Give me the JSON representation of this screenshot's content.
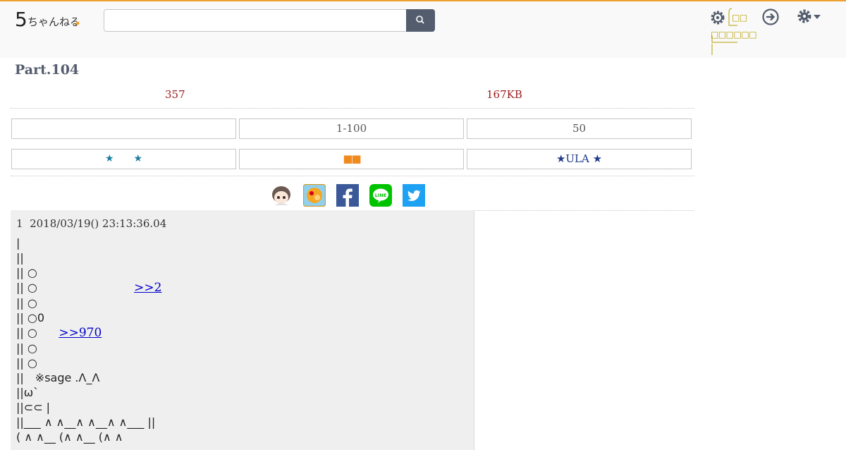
{
  "header": {
    "logo_text": "5ちゃんねる",
    "search": {
      "value": "",
      "placeholder": ""
    },
    "menu": {
      "item1": "□□",
      "item2": "□□□□□□"
    }
  },
  "thread": {
    "title": "Part.104",
    "response_count": "357",
    "size": "167KB"
  },
  "nav": {
    "row1": [
      "",
      "1-100",
      "50"
    ],
    "row2": {
      "left": "★　　★",
      "middle": "■■",
      "right": "★ULA ★"
    }
  },
  "share": {
    "icons": [
      "character-icon",
      "ball-icon",
      "facebook-icon",
      "line-icon",
      "twitter-icon"
    ],
    "line_label": "LINE"
  },
  "post": {
    "number": "1",
    "datetime": "2018/03/19() 23:13:36.04",
    "lines": [
      "|",
      "||",
      "|| ○",
      "|| ○",
      "|| ○",
      "|| ○0",
      "|| ○",
      "|| ○",
      "|| ○",
      "||　※sage .Λ_Λ",
      "||ω`",
      "||⊂⊂ |",
      "||___ ∧ ∧__∧ ∧__∧ ∧___ ||",
      "( ∧ ∧__ (∧ ∧__ (∧ ∧"
    ],
    "anchor_1": ">>2",
    "anchor_2": ">>970"
  },
  "colors": {
    "accent_top": "#f0a030",
    "header_button": "#545d6d",
    "meta_red": "#9b1c1c",
    "anchor": "#0000cc",
    "menu_gold": "#b8a000",
    "facebook": "#3b5998",
    "line": "#00c300",
    "twitter": "#1da1f2"
  }
}
